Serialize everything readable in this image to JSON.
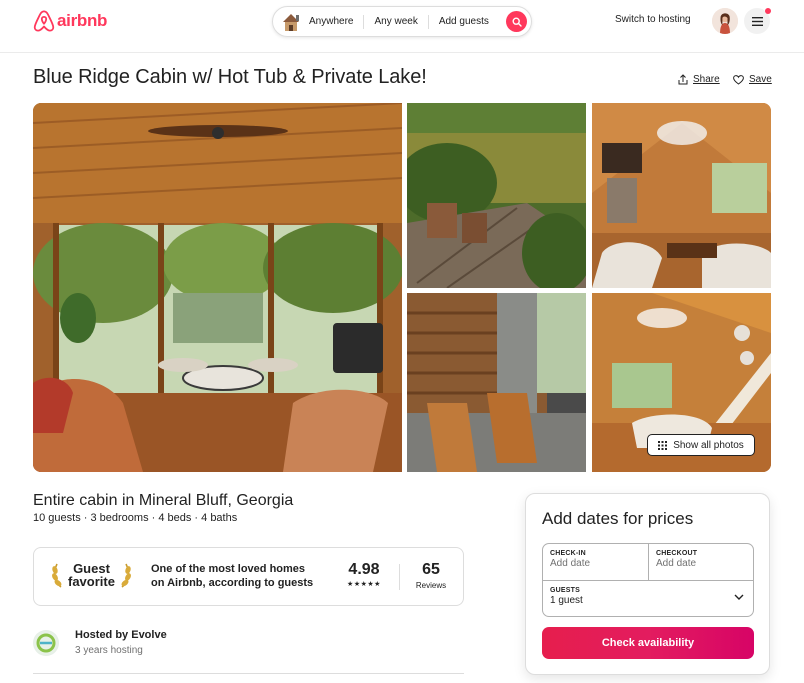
{
  "header": {
    "logo_text": "airbnb",
    "search": {
      "where": "Anywhere",
      "when": "Any week",
      "who": "Add guests"
    },
    "switch_to_hosting": "Switch to hosting"
  },
  "listing": {
    "title": "Blue Ridge Cabin w/ Hot Tub & Private Lake!",
    "share_label": "Share",
    "save_label": "Save",
    "show_all_photos": "Show all photos",
    "subtitle": "Entire cabin in Mineral Bluff, Georgia",
    "facts": "10 guests · 3 bedrooms · 4 beds · 4 baths"
  },
  "guest_favorite": {
    "badge_line1": "Guest",
    "badge_line2": "favorite",
    "description": "One of the most loved homes on Airbnb, according to guests",
    "rating": "4.98",
    "stars": "★★★★★",
    "reviews_count": "65",
    "reviews_label": "Reviews"
  },
  "host": {
    "name": "Hosted by Evolve",
    "years": "3 years hosting"
  },
  "booking": {
    "title": "Add dates for prices",
    "checkin_label": "CHECK-IN",
    "checkin_value": "Add date",
    "checkout_label": "CHECKOUT",
    "checkout_value": "Add date",
    "guests_label": "GUESTS",
    "guests_value": "1 guest",
    "cta": "Check availability"
  },
  "colors": {
    "brand": "#ff385c",
    "text": "#222222",
    "muted": "#717171",
    "border": "#dddddd"
  },
  "icons": [
    "airbnb-logo-icon",
    "house-icon",
    "search-icon",
    "menu-icon",
    "share-icon",
    "heart-icon",
    "grid-icon",
    "laurel-left-icon",
    "laurel-right-icon",
    "chevron-down-icon"
  ]
}
